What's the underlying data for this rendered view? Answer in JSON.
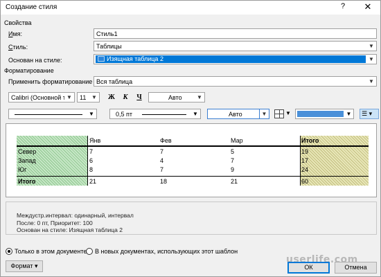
{
  "window": {
    "title": "Создание стиля",
    "help_glyph": "?",
    "close_glyph": "✕"
  },
  "properties": {
    "section_label": "Свойства",
    "name_label_u": "И",
    "name_label_rest": "мя:",
    "name_value": "Стиль1",
    "style_type_label_u": "С",
    "style_type_label_rest": "тиль:",
    "style_type_value": "Таблицы",
    "based_on_label": "Основан на стиле:",
    "based_on_value": "Изящная таблица 2"
  },
  "formatting": {
    "section_label": "Форматирование",
    "apply_to_label": "Применить форматирование к:",
    "apply_to_value": "Вся таблица",
    "font_name": "Calibri (Основной текс",
    "font_size": "11",
    "bold_glyph": "Ж",
    "italic_glyph": "К",
    "underline_glyph": "Ч",
    "font_color": "Авто",
    "line_width": "0,5 пт",
    "border_color": "Авто",
    "fill_color": "#4a90d9"
  },
  "preview_table": {
    "headers": [
      "",
      "Янв",
      "Фев",
      "Мар",
      "Итого"
    ],
    "rows": [
      [
        "Север",
        "7",
        "7",
        "5",
        "19"
      ],
      [
        "Запад",
        "6",
        "4",
        "7",
        "17"
      ],
      [
        "Юг",
        "8",
        "7",
        "9",
        "24"
      ],
      [
        "Итого",
        "21",
        "18",
        "21",
        "60"
      ]
    ]
  },
  "description": {
    "line1": "Междустр.интервал:  одинарный, интервал",
    "line2": "После:  0 пт, Приоритет: 100",
    "line3": "Основан на стиле: Изящная таблица 2"
  },
  "scope": {
    "this_doc": "Только в этом документе",
    "new_docs": "В новых документах, использующих этот шаблон",
    "selected": "this_doc"
  },
  "buttons": {
    "format": "Формат ▾",
    "ok": "ОК",
    "cancel": "Отмена"
  },
  "watermark": "userlife.com"
}
